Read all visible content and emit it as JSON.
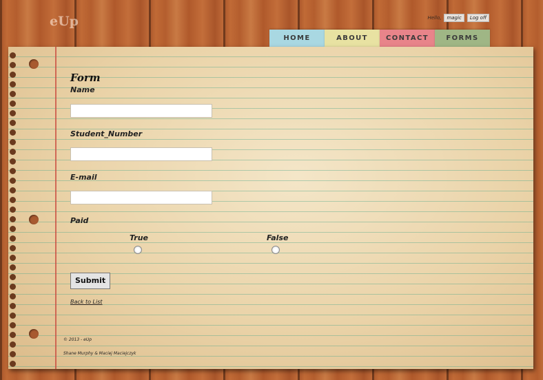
{
  "header": {
    "logo": "eUp",
    "hello": "Hello,",
    "user": "magic",
    "logoff": "Log off"
  },
  "nav": {
    "home": "HOME",
    "about": "ABOUT",
    "contact": "CONTACT",
    "forms": "FORMS"
  },
  "form": {
    "title": "Form",
    "fields": [
      {
        "label": "Name",
        "value": ""
      },
      {
        "label": "Student_Number",
        "value": ""
      },
      {
        "label": "E-mail",
        "value": ""
      }
    ],
    "paid": {
      "label": "Paid",
      "true_label": "True",
      "false_label": "False"
    },
    "submit": "Submit",
    "back": "Back to List"
  },
  "footer": {
    "copyright": "© 2013 - eUp",
    "authors": "Shane Murphy & Maciej Maciejczyk"
  },
  "colors": {
    "home_tab": "#a9d8e2",
    "about_tab": "#e8e2a2",
    "contact_tab": "#e8848a",
    "forms_tab": "#9fb685"
  }
}
